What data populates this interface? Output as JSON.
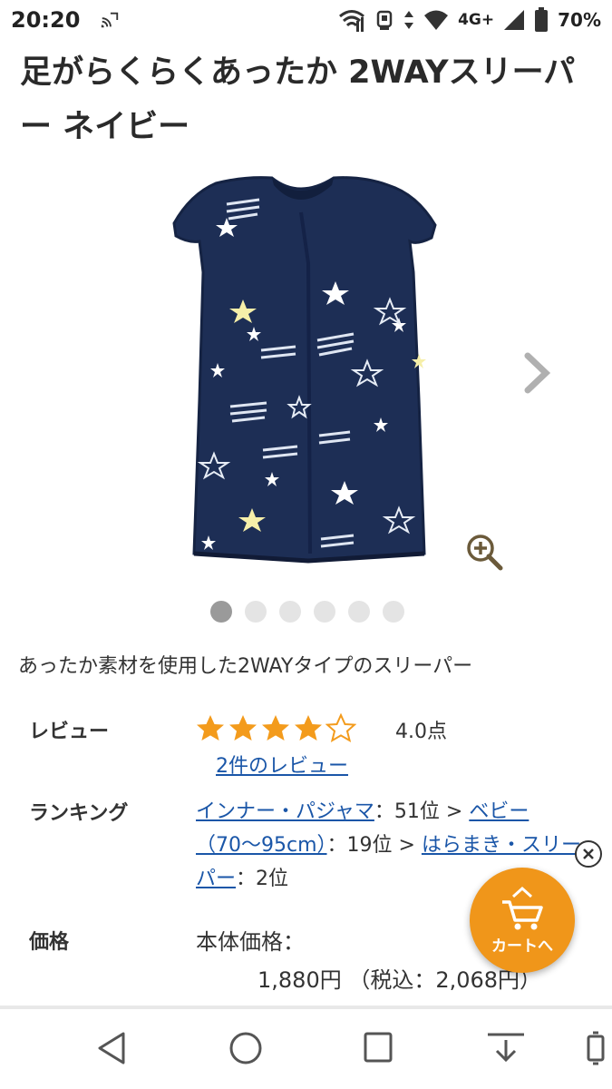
{
  "status_bar": {
    "time": "20:20",
    "network": "4G+",
    "battery": "70%",
    "icons": [
      "cast-icon",
      "wifi-icon",
      "alarm-icon",
      "data-arrows-icon",
      "signal-icon",
      "battery-icon"
    ]
  },
  "product": {
    "title": "足がらくらくあったか 2WAYスリーパー ネイビー",
    "description": "あったか素材を使用した2WAYタイプのスリーパー",
    "image_alt": "navy-star-sleeper",
    "carousel": {
      "count": 6,
      "active_index": 0
    }
  },
  "review": {
    "label": "レビュー",
    "rating": 4.0,
    "max_rating": 5,
    "score_text": "4.0点",
    "count_link": "2件のレビュー",
    "star_color": "#f39b1c"
  },
  "ranking": {
    "label": "ランキング",
    "cat1": "インナー・パジャマ",
    "rank1": "：51位",
    "sep1": " > ",
    "cat2": "ベビー（70〜95cm）",
    "rank2": "：19位",
    "sep2": " > ",
    "cat3": "はらまき・スリーパー",
    "rank3": "：2位"
  },
  "price": {
    "label": "価格",
    "body_label": "本体価格：",
    "price_text": "1,880円 （税込：2,068円）"
  },
  "cart_fab": {
    "label": "カートへ",
    "color": "#f0961a"
  },
  "nav": [
    "back-icon",
    "home-icon",
    "recents-icon",
    "notification-pull-icon",
    "rotate-icon"
  ]
}
